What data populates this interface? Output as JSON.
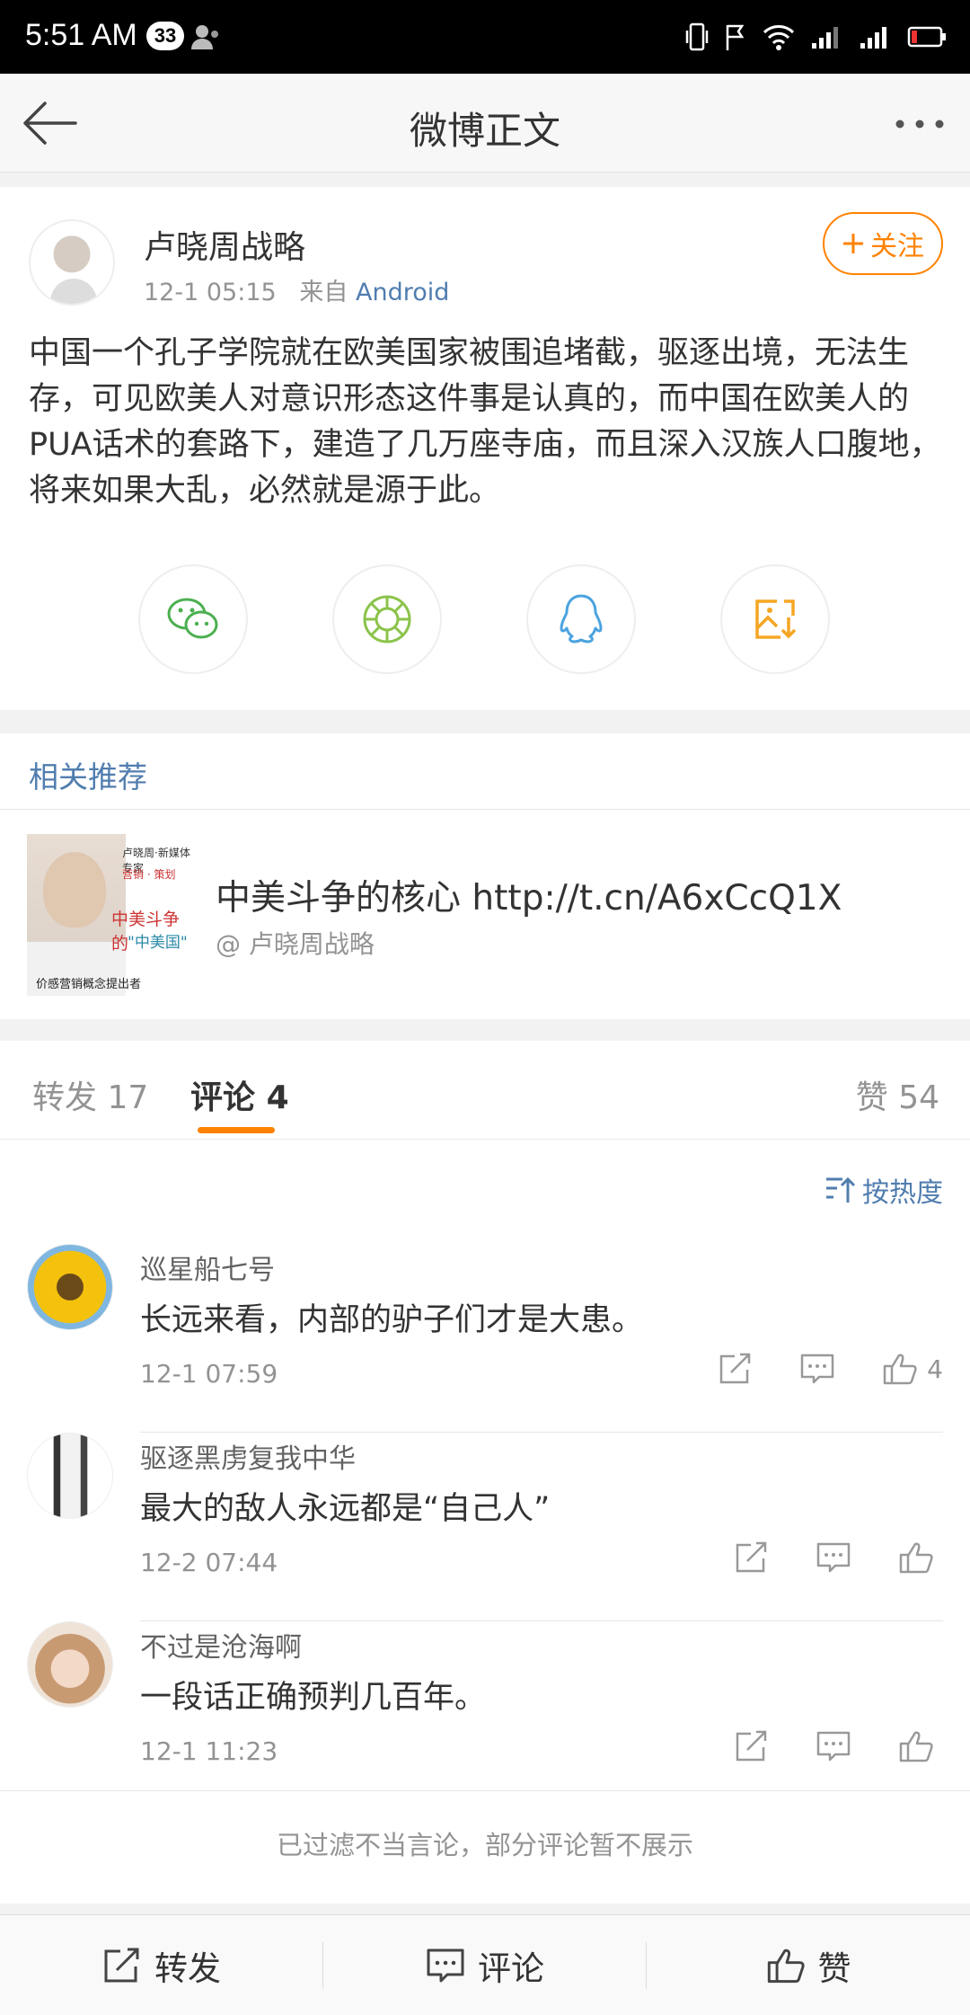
{
  "status_bar": {
    "time": "5:51 AM",
    "badge": "33"
  },
  "nav": {
    "title": "微博正文"
  },
  "post": {
    "author": "卢晓周战略",
    "time": "12-1 05:15",
    "source_prefix": "来自",
    "source": "Android",
    "follow_label": "关注",
    "text": "中国一个孔子学院就在欧美国家被围追堵截，驱逐出境，无法生存，可见欧美人对意识形态这件事是认真的，而中国在欧美人的PUA话术的套路下，建造了几万座寺庙，而且深入汉族人口腹地，将来如果大乱，必然就是源于此。",
    "share_icons": [
      "wechat-icon",
      "moments-icon",
      "qq-icon",
      "save-image-icon"
    ]
  },
  "related": {
    "section_title": "相关推荐",
    "headline": "中美斗争的核心  http://t.cn/A6xCcQ1X",
    "sub": "@ 卢晓周战略",
    "thumb": {
      "line1": "卢晓周·新媒体专家",
      "line2": "营销 · 策划",
      "line3": "中美斗争的",
      "line4": "\"中美国\"",
      "line5": "价感营销概念提出者"
    }
  },
  "tabs": {
    "repost_label": "转发",
    "repost_count": "17",
    "comment_label": "评论",
    "comment_count": "4",
    "like_label": "赞",
    "like_count": "54"
  },
  "sort_label": "按热度",
  "comments": [
    {
      "name": "巡星船七号",
      "text": "长远来看，内部的驴子们才是大患。",
      "time": "12-1 07:59",
      "likes": "4"
    },
    {
      "name": "驱逐黑虏复我中华",
      "text": "最大的敌人永远都是“自己人”",
      "time": "12-2 07:44",
      "likes": ""
    },
    {
      "name": "不过是沧海啊",
      "text": "一段话正确预判几百年。",
      "time": "12-1 11:23",
      "likes": ""
    }
  ],
  "filter_note": "已过滤不当言论，部分评论暂不展示",
  "bottom_bar": {
    "repost": "转发",
    "comment": "评论",
    "like": "赞"
  },
  "colors": {
    "accent": "#ff8200",
    "link": "#507daf",
    "secondary_text": "#939393"
  }
}
